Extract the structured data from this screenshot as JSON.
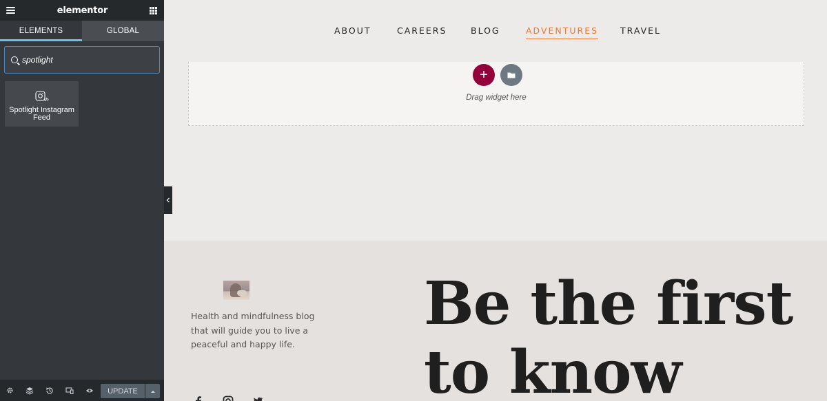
{
  "panel": {
    "brand": "elementor",
    "tabs": [
      {
        "label": "ELEMENTS",
        "active": true
      },
      {
        "label": "GLOBAL",
        "active": false
      }
    ],
    "search": {
      "value": "spotlight"
    },
    "widgets": [
      {
        "label": "Spotlight Instagram Feed",
        "icon": "instagram-code-icon"
      }
    ],
    "footer": {
      "icons": [
        "settings-icon",
        "layers-icon",
        "history-icon",
        "responsive-icon",
        "preview-icon"
      ],
      "update_label": "UPDATE"
    }
  },
  "nav": {
    "items": [
      {
        "label": "ABOUT",
        "active": false
      },
      {
        "label": "CAREERS",
        "active": false
      },
      {
        "label": "BLOG",
        "active": false
      },
      {
        "label": "ADVENTURES",
        "active": true
      },
      {
        "label": "TRAVEL",
        "active": false
      }
    ],
    "active_color": "#e3793b"
  },
  "dropzone": {
    "add_label": "+",
    "drag_text": "Drag widget here"
  },
  "footer_section": {
    "tagline": "Health and mindfulness blog that will guide you to live a peaceful and happy life.",
    "headline": "Be the first to know",
    "social_icons": [
      "facebook-icon",
      "instagram-icon",
      "twitter-icon"
    ]
  },
  "colors": {
    "panel_bg": "#34383c",
    "panel_header": "#26292c",
    "tab_accent": "#6ec1e4",
    "add_button": "#93003c",
    "folder_button": "#6d7882"
  }
}
